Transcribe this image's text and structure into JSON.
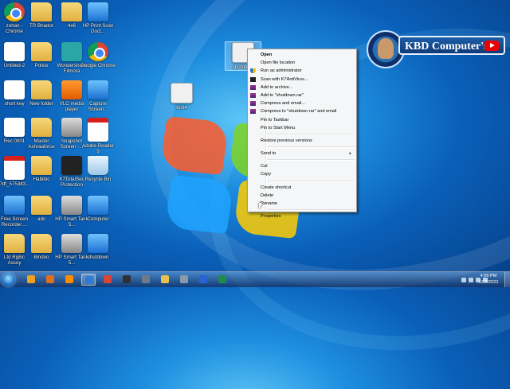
{
  "desktop_icons": [
    {
      "label": "zohan - Chrome",
      "type": "chrome"
    },
    {
      "label": "TR Bhador",
      "type": "folder"
    },
    {
      "label": "4x6",
      "type": "folder"
    },
    {
      "label": "HP Print Scan Doct...",
      "type": "blue"
    },
    {
      "label": "Untitled-2",
      "type": "doc"
    },
    {
      "label": "Police",
      "type": "folder"
    },
    {
      "label": "Wondershare Filmora",
      "type": "teal"
    },
    {
      "label": "Google Chrome",
      "type": "chrome"
    },
    {
      "label": "short key",
      "type": "doc"
    },
    {
      "label": "New folder",
      "type": "folder"
    },
    {
      "label": "VLC media player",
      "type": "orange"
    },
    {
      "label": "Capture Screen...",
      "type": "blue"
    },
    {
      "label": "Rec 0001",
      "type": "doc"
    },
    {
      "label": "Master Ashraaforce",
      "type": "folder"
    },
    {
      "label": "Snapshot Screen -...",
      "type": "printer"
    },
    {
      "label": "Adobe Reader 9",
      "type": "pdf"
    },
    {
      "label": "Pdf_575383...",
      "type": "pdf"
    },
    {
      "label": "Habibic",
      "type": "folder"
    },
    {
      "label": "K7TotalSec Protection",
      "type": "dark"
    },
    {
      "label": "Recycle Bin",
      "type": "trash"
    },
    {
      "label": "Free Screen Recorder ...",
      "type": "blue"
    },
    {
      "label": "adc",
      "type": "folder"
    },
    {
      "label": "HP Smart Tank 5...",
      "type": "printer"
    },
    {
      "label": "Computer",
      "type": "blue"
    },
    {
      "label": "Ltd Rg8ic Assoy",
      "type": "folder"
    },
    {
      "label": "Bindoo",
      "type": "folder"
    },
    {
      "label": "HP Smart Tank 5...",
      "type": "printer"
    },
    {
      "label": "shutdown",
      "type": "blue"
    }
  ],
  "extra_icons": {
    "selected_label": "shutdown",
    "other_label": "test4"
  },
  "watermark": {
    "brand_text": "KBD Computer's"
  },
  "context_menu": {
    "items": [
      {
        "label": "Open",
        "bold": true,
        "icon": ""
      },
      {
        "label": "Open file location",
        "icon": ""
      },
      {
        "label": "Run as administrator",
        "icon": "shield"
      },
      {
        "label": "Scan with K7AntiVirus...",
        "icon": "k7"
      },
      {
        "label": "Add to archive...",
        "icon": "rar"
      },
      {
        "label": "Add to \"shutdown.rar\"",
        "icon": "rar"
      },
      {
        "label": "Compress and email...",
        "icon": "rar"
      },
      {
        "label": "Compress to \"shutdown.rar\" and email",
        "icon": "rar"
      },
      {
        "label": "Pin to Taskbar",
        "icon": ""
      },
      {
        "label": "Pin to Start Menu",
        "icon": ""
      },
      {
        "sep": true
      },
      {
        "label": "Restore previous versions",
        "icon": ""
      },
      {
        "sep": true
      },
      {
        "label": "Send to",
        "icon": "",
        "submenu": true
      },
      {
        "sep": true
      },
      {
        "label": "Cut",
        "icon": ""
      },
      {
        "label": "Copy",
        "icon": ""
      },
      {
        "sep": true
      },
      {
        "label": "Create shortcut",
        "icon": ""
      },
      {
        "label": "Delete",
        "icon": ""
      },
      {
        "label": "Rename",
        "icon": ""
      },
      {
        "sep": true
      },
      {
        "label": "Properties",
        "icon": ""
      }
    ],
    "submenu_arrow": "▸"
  },
  "taskbar": {
    "apps": [
      {
        "name": "media-player",
        "color": "#f0a020"
      },
      {
        "name": "media-player-2",
        "color": "#e07020"
      },
      {
        "name": "vlc",
        "color": "#ff8c00"
      },
      {
        "name": "recorder",
        "color": "#2e7bd6",
        "active": true
      },
      {
        "name": "chrome",
        "color": "#db4437"
      },
      {
        "name": "k7",
        "color": "#303030"
      },
      {
        "name": "explorer",
        "color": "#6b7b8c"
      },
      {
        "name": "folder",
        "color": "#e8c050"
      },
      {
        "name": "file-manager",
        "color": "#8a9aaa"
      },
      {
        "name": "bluetooth",
        "color": "#2a62d4"
      },
      {
        "name": "excel",
        "color": "#1f8a4c"
      }
    ],
    "time": "4:56 PM",
    "date": "12/2/2022"
  }
}
